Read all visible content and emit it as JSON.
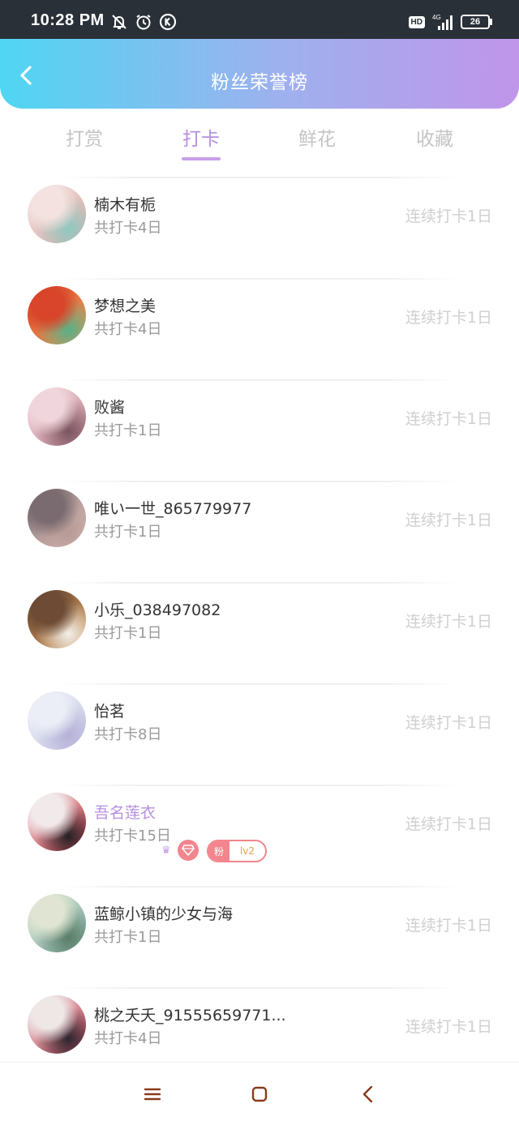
{
  "status_bar": {
    "time": "10:28 PM",
    "left_icons": [
      "bell-off-icon",
      "alarm-icon",
      "k-app-icon"
    ],
    "hd": "HD",
    "network": "4G",
    "battery": "26"
  },
  "header": {
    "title": "粉丝荣誉榜",
    "back_icon": "chevron-left-icon"
  },
  "tabs": [
    {
      "label": "打赏",
      "active": false
    },
    {
      "label": "打卡",
      "active": true
    },
    {
      "label": "鲜花",
      "active": false
    },
    {
      "label": "收藏",
      "active": false
    }
  ],
  "list": [
    {
      "name": "楠木有栀",
      "checkins": "共打卡4日",
      "streak": "连续打卡1日",
      "avatar_colors": [
        "#f3e2e0",
        "#d9a6a3",
        "#8fc9c1"
      ]
    },
    {
      "name": "梦想之美",
      "checkins": "共打卡4日",
      "streak": "连续打卡1日",
      "avatar_colors": [
        "#d8452a",
        "#f2a45a",
        "#57b087"
      ]
    },
    {
      "name": "败酱",
      "checkins": "共打卡1日",
      "streak": "连续打卡1日",
      "avatar_colors": [
        "#f0d6dc",
        "#c98b99",
        "#7a5560"
      ]
    },
    {
      "name": "唯い一世_865779977",
      "checkins": "共打卡1日",
      "streak": "连续打卡1日",
      "avatar_colors": [
        "#7a6b70",
        "#e8c8c0",
        "#b79a95"
      ]
    },
    {
      "name": "小乐_038497082",
      "checkins": "共打卡1日",
      "streak": "连续打卡1日",
      "avatar_colors": [
        "#6e4b35",
        "#d59b5c",
        "#f2efe8"
      ]
    },
    {
      "name": "怡茗",
      "checkins": "共打卡8日",
      "streak": "连续打卡1日",
      "avatar_colors": [
        "#eceef7",
        "#c9cfe6",
        "#b7b0d8"
      ]
    },
    {
      "name": "吾名莲衣",
      "checkins": "共打卡15日",
      "streak": "连续打卡1日",
      "avatar_colors": [
        "#f2e9ea",
        "#c7303c",
        "#242126"
      ],
      "vip": true,
      "crown_icon": "crown-icon",
      "diamond_icon": "diamond-icon",
      "fan_badge_label": "粉",
      "fan_badge_level": "lv2"
    },
    {
      "name": "蓝鲸小镇的少女与海",
      "checkins": "共打卡1日",
      "streak": "连续打卡1日",
      "avatar_colors": [
        "#dfe5d2",
        "#7fb0a8",
        "#5a7c68"
      ]
    },
    {
      "name": "桃之夭夭_91555659771...",
      "checkins": "共打卡4日",
      "streak": "连续打卡1日",
      "avatar_colors": [
        "#efe6e6",
        "#c23a4b",
        "#2c2630"
      ]
    }
  ],
  "navbar": {
    "icons": [
      "menu-icon",
      "home-square-icon",
      "back-triangle-icon"
    ],
    "icon_color": "#8a3a1a"
  },
  "colors": {
    "accent": "#b68fe0",
    "header_gradient": [
      "#4fd6f2",
      "#9fb0ee",
      "#c095ea"
    ],
    "badge_pink": "#f2858d"
  }
}
